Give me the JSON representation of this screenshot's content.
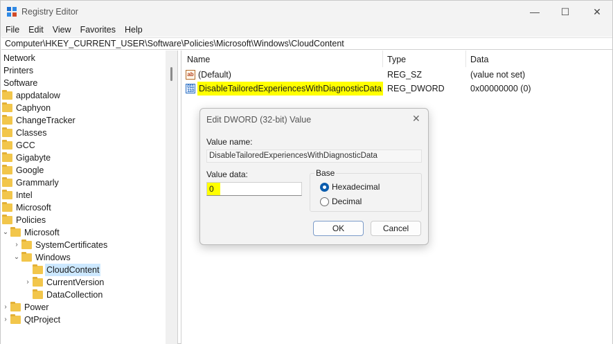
{
  "window": {
    "title": "Registry Editor",
    "minimize": "—",
    "maximize": "☐",
    "close": "✕"
  },
  "menu": [
    "File",
    "Edit",
    "View",
    "Favorites",
    "Help"
  ],
  "address": "Computer\\HKEY_CURRENT_USER\\Software\\Policies\\Microsoft\\Windows\\CloudContent",
  "tree": {
    "top_items": [
      "Network",
      "Printers",
      "Software"
    ],
    "folders": [
      "appdatalow",
      "Caphyon",
      "ChangeTracker",
      "Classes",
      "GCC",
      "Gigabyte",
      "Google",
      "Grammarly",
      "Intel",
      "Microsoft",
      "Policies"
    ],
    "policies_child": "Microsoft",
    "ms_children": [
      "SystemCertificates",
      "Windows"
    ],
    "windows_children": [
      "CloudContent",
      "CurrentVersion",
      "DataCollection"
    ],
    "after": [
      "Power",
      "QtProject"
    ],
    "selected": "CloudContent"
  },
  "list": {
    "headers": {
      "name": "Name",
      "type": "Type",
      "data": "Data"
    },
    "rows": [
      {
        "name": "(Default)",
        "type": "REG_SZ",
        "data": "(value not set)",
        "icon": "string-value-icon"
      },
      {
        "name": "DisableTailoredExperiencesWithDiagnosticData",
        "type": "REG_DWORD",
        "data": "0x00000000 (0)",
        "icon": "binary-value-icon"
      }
    ]
  },
  "dialog": {
    "title": "Edit DWORD (32-bit) Value",
    "close": "✕",
    "value_name_label": "Value name:",
    "value_name": "DisableTailoredExperiencesWithDiagnosticData",
    "value_data_label": "Value data:",
    "value_data": "0",
    "base_label": "Base",
    "hex_label": "Hexadecimal",
    "dec_label": "Decimal",
    "selected_base": "Hexadecimal",
    "ok": "OK",
    "cancel": "Cancel"
  },
  "colors": {
    "highlight": "#ffff00",
    "selection": "#cce8ff",
    "folder": "#f2c64b"
  }
}
